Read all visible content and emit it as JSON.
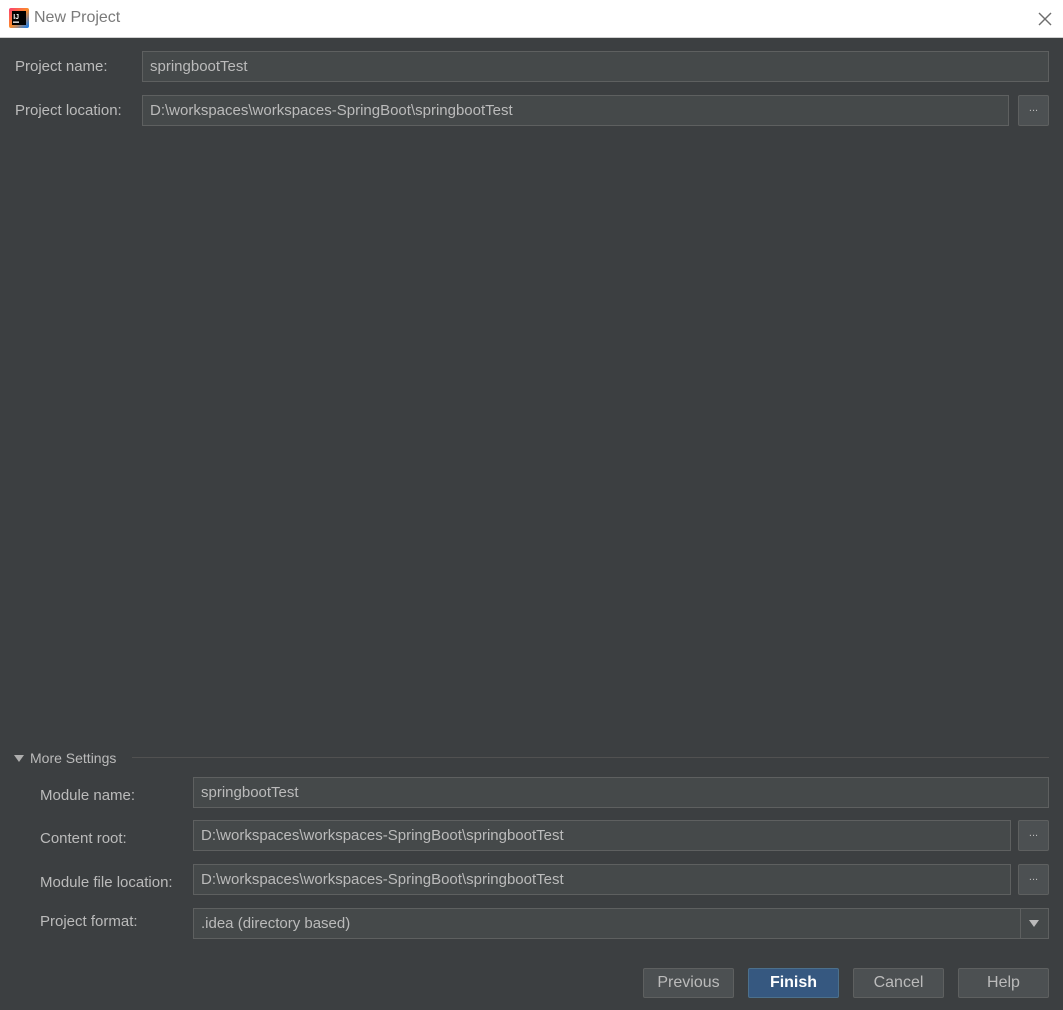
{
  "window": {
    "title": "New Project",
    "app_icon": "intellij-idea-icon",
    "close_icon": "close-icon"
  },
  "project": {
    "name_label": "Project name:",
    "name_value": "springbootTest",
    "location_label": "Project location:",
    "location_value": "D:\\workspaces\\workspaces-SpringBoot\\springbootTest",
    "browse_label": "..."
  },
  "more_settings": {
    "header": "More Settings",
    "expanded": true,
    "module_name_label": "Module name:",
    "module_name_value": "springbootTest",
    "content_root_label": "Content root:",
    "content_root_value": "D:\\workspaces\\workspaces-SpringBoot\\springbootTest",
    "module_file_label": "Module file location:",
    "module_file_value": "D:\\workspaces\\workspaces-SpringBoot\\springbootTest",
    "format_label": "Project format:",
    "format_value": ".idea (directory based)",
    "browse_label": "..."
  },
  "buttons": {
    "previous": "Previous",
    "finish": "Finish",
    "cancel": "Cancel",
    "help": "Help"
  },
  "colors": {
    "background": "#3c3f41",
    "field_bg": "#45494a",
    "primary_button": "#365880"
  }
}
